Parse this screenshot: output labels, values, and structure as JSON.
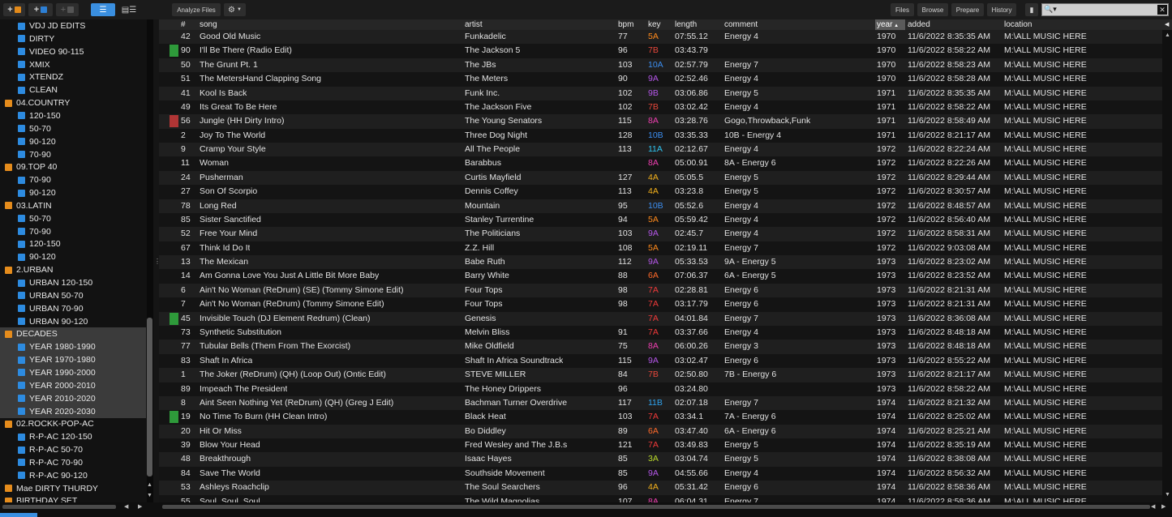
{
  "toolbar": {
    "analyze_label": "Analyze Files",
    "files_label": "Files",
    "browse_label": "Browse",
    "prepare_label": "Prepare",
    "history_label": "History",
    "search_value": ""
  },
  "colors": {
    "accent": "#3a8fe0",
    "key_orange": "#ff8a1c",
    "key_red": "#e8473b",
    "key_blue": "#3c8ef0",
    "key_cyan": "#2fc4f0",
    "key_purple": "#b456e8",
    "key_magenta": "#ee3fb0",
    "key_yellow": "#e8d02a",
    "key_green": "#6ad936"
  },
  "sidebar": {
    "items": [
      {
        "label": "VDJ JD EDITS",
        "icon": "blue-folder-icon",
        "indent": 1
      },
      {
        "label": "DIRTY",
        "icon": "blue-folder-icon",
        "indent": 1
      },
      {
        "label": "VIDEO 90-115",
        "icon": "blue-folder-icon",
        "indent": 1
      },
      {
        "label": "XMIX",
        "icon": "blue-folder-icon",
        "indent": 1
      },
      {
        "label": "XTENDZ",
        "icon": "blue-folder-icon",
        "indent": 1
      },
      {
        "label": "CLEAN",
        "icon": "blue-folder-icon",
        "indent": 1
      },
      {
        "label": "04.COUNTRY",
        "icon": "orange-folder-icon",
        "indent": 0
      },
      {
        "label": "120-150",
        "icon": "blue-folder-icon",
        "indent": 1
      },
      {
        "label": "50-70",
        "icon": "blue-folder-icon",
        "indent": 1
      },
      {
        "label": "90-120",
        "icon": "blue-folder-icon",
        "indent": 1
      },
      {
        "label": "70-90",
        "icon": "blue-folder-icon",
        "indent": 1
      },
      {
        "label": "09.TOP 40",
        "icon": "orange-folder-icon",
        "indent": 0
      },
      {
        "label": "70-90",
        "icon": "blue-folder-icon",
        "indent": 1
      },
      {
        "label": "90-120",
        "icon": "blue-folder-icon",
        "indent": 1
      },
      {
        "label": "03.LATIN",
        "icon": "orange-folder-icon",
        "indent": 0
      },
      {
        "label": "50-70",
        "icon": "blue-folder-icon",
        "indent": 1
      },
      {
        "label": "70-90",
        "icon": "blue-folder-icon",
        "indent": 1
      },
      {
        "label": "120-150",
        "icon": "blue-folder-icon",
        "indent": 1
      },
      {
        "label": "90-120",
        "icon": "blue-folder-icon",
        "indent": 1
      },
      {
        "label": "2.URBAN",
        "icon": "orange-folder-icon",
        "indent": 0
      },
      {
        "label": "URBAN 120-150",
        "icon": "blue-folder-icon",
        "indent": 1
      },
      {
        "label": "URBAN 50-70",
        "icon": "blue-folder-icon",
        "indent": 1
      },
      {
        "label": "URBAN 70-90",
        "icon": "blue-folder-icon",
        "indent": 1
      },
      {
        "label": "URBAN 90-120",
        "icon": "blue-folder-icon",
        "indent": 1
      },
      {
        "label": "DECADES",
        "icon": "orange-folder-icon",
        "indent": 0,
        "highlight": true
      },
      {
        "label": "YEAR 1980-1990",
        "icon": "blue-folder-icon",
        "indent": 1,
        "highlight": true
      },
      {
        "label": "YEAR 1970-1980",
        "icon": "blue-folder-icon",
        "indent": 1,
        "highlight": true
      },
      {
        "label": "YEAR 1990-2000",
        "icon": "blue-folder-icon",
        "indent": 1,
        "highlight": true
      },
      {
        "label": "YEAR 2000-2010",
        "icon": "blue-folder-icon",
        "indent": 1,
        "highlight": true
      },
      {
        "label": "YEAR 2010-2020",
        "icon": "blue-folder-icon",
        "indent": 1,
        "highlight": true
      },
      {
        "label": "YEAR 2020-2030",
        "icon": "blue-folder-icon",
        "indent": 1,
        "highlight": true
      },
      {
        "label": "02.ROCKK-POP-AC",
        "icon": "orange-folder-icon",
        "indent": 0
      },
      {
        "label": "R-P-AC 120-150",
        "icon": "blue-folder-icon",
        "indent": 1
      },
      {
        "label": "R-P-AC 50-70",
        "icon": "blue-folder-icon",
        "indent": 1
      },
      {
        "label": "R-P-AC 70-90",
        "icon": "blue-folder-icon",
        "indent": 1
      },
      {
        "label": "R-P-AC 90-120",
        "icon": "blue-folder-icon",
        "indent": 1
      },
      {
        "label": "Mae DIRTY THURDY",
        "icon": "orange-folder-icon",
        "indent": 0
      },
      {
        "label": "BIRTHDAY SET",
        "icon": "orange-folder-icon",
        "indent": 0
      }
    ]
  },
  "table": {
    "columns": [
      "#",
      "song",
      "artist",
      "bpm",
      "key",
      "length",
      "comment",
      "year",
      "added",
      "location"
    ],
    "sort_column": "year",
    "rows": [
      {
        "num": "42",
        "song": "Good Old Music",
        "artist": "Funkadelic",
        "bpm": "77",
        "key": "5A",
        "key_color": "#ff8a1c",
        "length": "07:55.12",
        "comment": "Energy 4",
        "year": "1970",
        "added": "11/6/2022 8:35:35 AM",
        "location": "M:\\ALL MUSIC HERE",
        "mark": ""
      },
      {
        "num": "90",
        "song": "I'll Be There (Radio Edit)",
        "artist": "The Jackson 5",
        "bpm": "96",
        "key": "7B",
        "key_color": "#e8473b",
        "length": "03:43.79",
        "comment": "",
        "year": "1970",
        "added": "11/6/2022 8:58:22 AM",
        "location": "M:\\ALL MUSIC HERE",
        "mark": "#2e9a3a"
      },
      {
        "num": "50",
        "song": "The Grunt Pt. 1",
        "artist": "The JBs",
        "bpm": "103",
        "key": "10A",
        "key_color": "#3c8ef0",
        "length": "02:57.79",
        "comment": "Energy 7",
        "year": "1970",
        "added": "11/6/2022 8:58:23 AM",
        "location": "M:\\ALL MUSIC HERE",
        "mark": ""
      },
      {
        "num": "51",
        "song": "The MetersHand Clapping Song",
        "artist": "The Meters",
        "bpm": "90",
        "key": "9A",
        "key_color": "#b456e8",
        "length": "02:52.46",
        "comment": "Energy 4",
        "year": "1970",
        "added": "11/6/2022 8:58:28 AM",
        "location": "M:\\ALL MUSIC HERE",
        "mark": ""
      },
      {
        "num": "41",
        "song": "Kool Is Back",
        "artist": "Funk Inc.",
        "bpm": "102",
        "key": "9B",
        "key_color": "#b456e8",
        "length": "03:06.86",
        "comment": "Energy 5",
        "year": "1971",
        "added": "11/6/2022 8:35:35 AM",
        "location": "M:\\ALL MUSIC HERE",
        "mark": ""
      },
      {
        "num": "49",
        "song": "Its Great To Be Here",
        "artist": "The Jackson Five",
        "bpm": "102",
        "key": "7B",
        "key_color": "#e8473b",
        "length": "03:02.42",
        "comment": "Energy 4",
        "year": "1971",
        "added": "11/6/2022 8:58:22 AM",
        "location": "M:\\ALL MUSIC HERE",
        "mark": ""
      },
      {
        "num": "56",
        "song": "Jungle (HH Dirty Intro)",
        "artist": "The Young Senators",
        "bpm": "115",
        "key": "8A",
        "key_color": "#ee3fb0",
        "length": "03:28.76",
        "comment": "Gogo,Throwback,Funk",
        "year": "1971",
        "added": "11/6/2022 8:58:49 AM",
        "location": "M:\\ALL MUSIC HERE",
        "mark": "#b03535"
      },
      {
        "num": "2",
        "song": "Joy To The World",
        "artist": "Three Dog Night",
        "bpm": "128",
        "key": "10B",
        "key_color": "#3c8ef0",
        "length": "03:35.33",
        "comment": "10B - Energy 4",
        "year": "1971",
        "added": "11/6/2022 8:21:17 AM",
        "location": "M:\\ALL MUSIC HERE",
        "mark": ""
      },
      {
        "num": "9",
        "song": "Cramp Your Style",
        "artist": "All The People",
        "bpm": "113",
        "key": "11A",
        "key_color": "#2fc4f0",
        "length": "02:12.67",
        "comment": "Energy 4",
        "year": "1972",
        "added": "11/6/2022 8:22:24 AM",
        "location": "M:\\ALL MUSIC HERE",
        "mark": ""
      },
      {
        "num": "11",
        "song": "Woman",
        "artist": "Barabbus",
        "bpm": "",
        "key": "8A",
        "key_color": "#ee3fb0",
        "length": "05:00.91",
        "comment": "8A - Energy 6",
        "year": "1972",
        "added": "11/6/2022 8:22:26 AM",
        "location": "M:\\ALL MUSIC HERE",
        "mark": ""
      },
      {
        "num": "24",
        "song": "Pusherman",
        "artist": "Curtis Mayfield",
        "bpm": "127",
        "key": "4A",
        "key_color": "#f5b21c",
        "length": "05:05.5",
        "comment": "Energy 5",
        "year": "1972",
        "added": "11/6/2022 8:29:44 AM",
        "location": "M:\\ALL MUSIC HERE",
        "mark": ""
      },
      {
        "num": "27",
        "song": "Son Of Scorpio",
        "artist": "Dennis Coffey",
        "bpm": "113",
        "key": "4A",
        "key_color": "#f5b21c",
        "length": "03:23.8",
        "comment": "Energy 5",
        "year": "1972",
        "added": "11/6/2022 8:30:57 AM",
        "location": "M:\\ALL MUSIC HERE",
        "mark": ""
      },
      {
        "num": "78",
        "song": "Long Red",
        "artist": "Mountain",
        "bpm": "95",
        "key": "10B",
        "key_color": "#3c8ef0",
        "length": "05:52.6",
        "comment": "Energy 4",
        "year": "1972",
        "added": "11/6/2022 8:48:57 AM",
        "location": "M:\\ALL MUSIC HERE",
        "mark": ""
      },
      {
        "num": "85",
        "song": "Sister Sanctified",
        "artist": "Stanley Turrentine",
        "bpm": "94",
        "key": "5A",
        "key_color": "#ff8a1c",
        "length": "05:59.42",
        "comment": "Energy 4",
        "year": "1972",
        "added": "11/6/2022 8:56:40 AM",
        "location": "M:\\ALL MUSIC HERE",
        "mark": ""
      },
      {
        "num": "52",
        "song": "Free Your Mind",
        "artist": "The Politicians",
        "bpm": "103",
        "key": "9A",
        "key_color": "#b456e8",
        "length": "02:45.7",
        "comment": "Energy 4",
        "year": "1972",
        "added": "11/6/2022 8:58:31 AM",
        "location": "M:\\ALL MUSIC HERE",
        "mark": ""
      },
      {
        "num": "67",
        "song": "Think Id Do It",
        "artist": "Z.Z. Hill",
        "bpm": "108",
        "key": "5A",
        "key_color": "#ff8a1c",
        "length": "02:19.11",
        "comment": "Energy 7",
        "year": "1972",
        "added": "11/6/2022 9:03:08 AM",
        "location": "M:\\ALL MUSIC HERE",
        "mark": ""
      },
      {
        "num": "13",
        "song": "The Mexican",
        "artist": "Babe Ruth",
        "bpm": "112",
        "key": "9A",
        "key_color": "#b456e8",
        "length": "05:33.53",
        "comment": "9A - Energy 5",
        "year": "1973",
        "added": "11/6/2022 8:23:02 AM",
        "location": "M:\\ALL MUSIC HERE",
        "mark": ""
      },
      {
        "num": "14",
        "song": "Am Gonna Love You Just A Little Bit More Baby",
        "artist": "Barry White",
        "bpm": "88",
        "key": "6A",
        "key_color": "#ff6a2a",
        "length": "07:06.37",
        "comment": "6A - Energy 5",
        "year": "1973",
        "added": "11/6/2022 8:23:52 AM",
        "location": "M:\\ALL MUSIC HERE",
        "mark": ""
      },
      {
        "num": "6",
        "song": "Ain't No Woman (ReDrum) (SE) (Tommy Simone Edit)",
        "artist": "Four Tops",
        "bpm": "98",
        "key": "7A",
        "key_color": "#f03a3a",
        "length": "02:28.81",
        "comment": "Energy 6",
        "year": "1973",
        "added": "11/6/2022 8:21:31 AM",
        "location": "M:\\ALL MUSIC HERE",
        "mark": ""
      },
      {
        "num": "7",
        "song": "Ain't No Woman (ReDrum) (Tommy Simone Edit)",
        "artist": "Four Tops",
        "bpm": "98",
        "key": "7A",
        "key_color": "#f03a3a",
        "length": "03:17.79",
        "comment": "Energy 6",
        "year": "1973",
        "added": "11/6/2022 8:21:31 AM",
        "location": "M:\\ALL MUSIC HERE",
        "mark": ""
      },
      {
        "num": "45",
        "song": "Invisible Touch (DJ Element Redrum) (Clean)",
        "artist": "Genesis",
        "bpm": "",
        "key": "7A",
        "key_color": "#f03a3a",
        "length": "04:01.84",
        "comment": "Energy 7",
        "year": "1973",
        "added": "11/6/2022 8:36:08 AM",
        "location": "M:\\ALL MUSIC HERE",
        "mark": "#2e9a3a"
      },
      {
        "num": "73",
        "song": "Synthetic Substitution",
        "artist": "Melvin Bliss",
        "bpm": "91",
        "key": "7A",
        "key_color": "#f03a3a",
        "length": "03:37.66",
        "comment": "Energy 4",
        "year": "1973",
        "added": "11/6/2022 8:48:18 AM",
        "location": "M:\\ALL MUSIC HERE",
        "mark": ""
      },
      {
        "num": "77",
        "song": "Tubular Bells (Them From The Exorcist)",
        "artist": "Mike Oldfield",
        "bpm": "75",
        "key": "8A",
        "key_color": "#ee3fb0",
        "length": "06:00.26",
        "comment": "Energy 3",
        "year": "1973",
        "added": "11/6/2022 8:48:18 AM",
        "location": "M:\\ALL MUSIC HERE",
        "mark": ""
      },
      {
        "num": "83",
        "song": "Shaft In Africa",
        "artist": "Shaft In Africa Soundtrack",
        "bpm": "115",
        "key": "9A",
        "key_color": "#b456e8",
        "length": "03:02.47",
        "comment": "Energy 6",
        "year": "1973",
        "added": "11/6/2022 8:55:22 AM",
        "location": "M:\\ALL MUSIC HERE",
        "mark": ""
      },
      {
        "num": "1",
        "song": "The Joker (ReDrum) (QH) (Loop Out) (Ontic Edit)",
        "artist": "STEVE MILLER",
        "bpm": "84",
        "key": "7B",
        "key_color": "#e8473b",
        "length": "02:50.80",
        "comment": "7B - Energy 6",
        "year": "1973",
        "added": "11/6/2022 8:21:17 AM",
        "location": "M:\\ALL MUSIC HERE",
        "mark": ""
      },
      {
        "num": "89",
        "song": "Impeach The President",
        "artist": "The Honey Drippers",
        "bpm": "96",
        "key": "",
        "key_color": "#ffffff",
        "length": "03:24.80",
        "comment": "",
        "year": "1973",
        "added": "11/6/2022 8:58:22 AM",
        "location": "M:\\ALL MUSIC HERE",
        "mark": ""
      },
      {
        "num": "8",
        "song": "Aint Seen Nothing Yet (ReDrum) (QH) (Greg J Edit)",
        "artist": "Bachman Turner Overdrive",
        "bpm": "117",
        "key": "11B",
        "key_color": "#2fa4f0",
        "length": "02:07.18",
        "comment": "Energy 7",
        "year": "1974",
        "added": "11/6/2022 8:21:32 AM",
        "location": "M:\\ALL MUSIC HERE",
        "mark": ""
      },
      {
        "num": "19",
        "song": "No Time To Burn (HH Clean Intro)",
        "artist": "Black Heat",
        "bpm": "103",
        "key": "7A",
        "key_color": "#f03a3a",
        "length": "03:34.1",
        "comment": "7A - Energy 6",
        "year": "1974",
        "added": "11/6/2022 8:25:02 AM",
        "location": "M:\\ALL MUSIC HERE",
        "mark": "#2e9a3a"
      },
      {
        "num": "20",
        "song": "Hit Or Miss",
        "artist": "Bo Diddley",
        "bpm": "89",
        "key": "6A",
        "key_color": "#ff6a2a",
        "length": "03:47.40",
        "comment": "6A - Energy 6",
        "year": "1974",
        "added": "11/6/2022 8:25:21 AM",
        "location": "M:\\ALL MUSIC HERE",
        "mark": ""
      },
      {
        "num": "39",
        "song": "Blow Your Head",
        "artist": "Fred Wesley and The J.B.s",
        "bpm": "121",
        "key": "7A",
        "key_color": "#f03a3a",
        "length": "03:49.83",
        "comment": "Energy 5",
        "year": "1974",
        "added": "11/6/2022 8:35:19 AM",
        "location": "M:\\ALL MUSIC HERE",
        "mark": ""
      },
      {
        "num": "48",
        "song": "Breakthrough",
        "artist": "Isaac Hayes",
        "bpm": "85",
        "key": "3A",
        "key_color": "#b8d82a",
        "length": "03:04.74",
        "comment": "Energy 5",
        "year": "1974",
        "added": "11/6/2022 8:38:08 AM",
        "location": "M:\\ALL MUSIC HERE",
        "mark": ""
      },
      {
        "num": "84",
        "song": "Save The World",
        "artist": "Southside Movement",
        "bpm": "85",
        "key": "9A",
        "key_color": "#b456e8",
        "length": "04:55.66",
        "comment": "Energy 4",
        "year": "1974",
        "added": "11/6/2022 8:56:32 AM",
        "location": "M:\\ALL MUSIC HERE",
        "mark": ""
      },
      {
        "num": "53",
        "song": "Ashleys Roachclip",
        "artist": "The Soul Searchers",
        "bpm": "96",
        "key": "4A",
        "key_color": "#f5b21c",
        "length": "05:31.42",
        "comment": "Energy 6",
        "year": "1974",
        "added": "11/6/2022 8:58:36 AM",
        "location": "M:\\ALL MUSIC HERE",
        "mark": ""
      },
      {
        "num": "55",
        "song": "Soul, Soul, Soul",
        "artist": "The Wild Magnolias",
        "bpm": "107",
        "key": "8A",
        "key_color": "#ee3fb0",
        "length": "06:04.31",
        "comment": "Energy 7",
        "year": "1974",
        "added": "11/6/2022 8:58:36 AM",
        "location": "M:\\ALL MUSIC HERE",
        "mark": ""
      }
    ]
  }
}
